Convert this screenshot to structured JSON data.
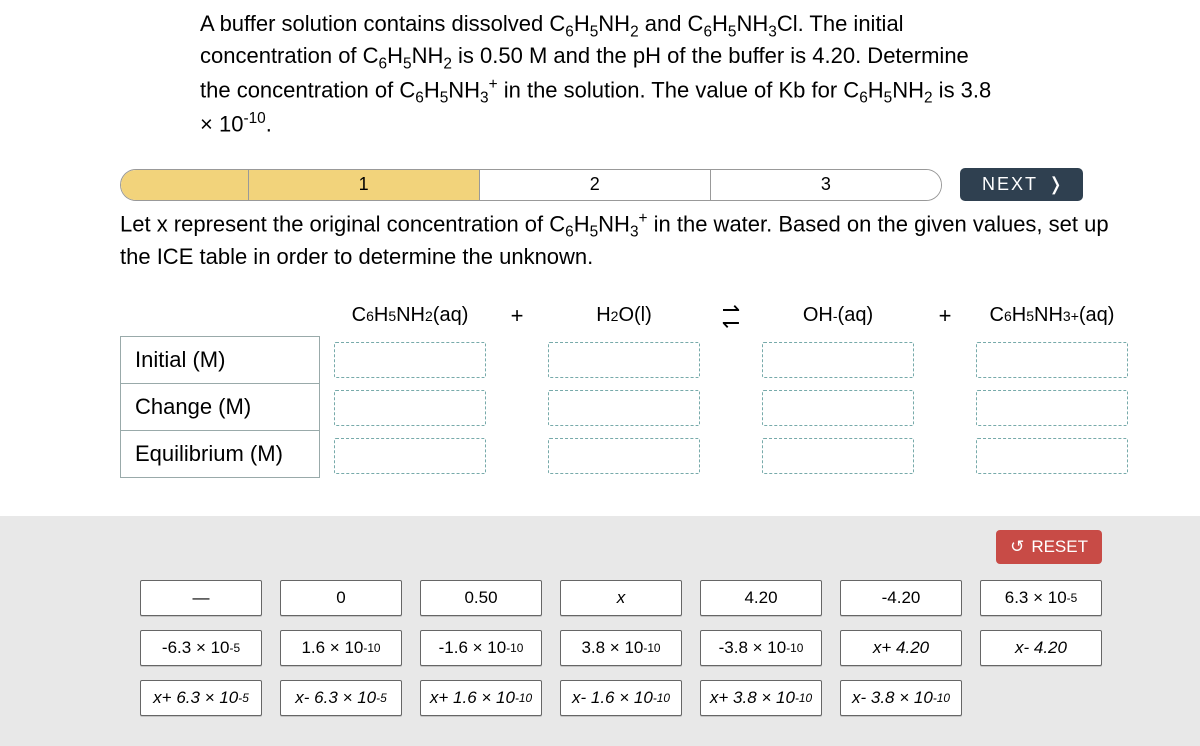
{
  "problem_html": "A buffer solution contains dissolved C<sub>6</sub>H<sub>5</sub>NH<sub>2</sub> and C<sub>6</sub>H<sub>5</sub>NH<sub>3</sub>Cl. The initial concentration of C<sub>6</sub>H<sub>5</sub>NH<sub>2</sub> is 0.50 M and the pH of the buffer is 4.20. Determine the concentration of C<sub>6</sub>H<sub>5</sub>NH<sub>3</sub><sup>+</sup> in the solution. The value of Kb for C<sub>6</sub>H<sub>5</sub>NH<sub>2</sub> is 3.8 × 10<sup>-10</sup>.",
  "steps": [
    "1",
    "2",
    "3"
  ],
  "next_label": "NEXT",
  "instruction_html": "Let x represent the original concentration of C<sub>6</sub>H<sub>5</sub>NH<sub>3</sub><sup>+</sup> in the water. Based on the given values, set up the ICE table in order to determine the unknown.",
  "ice": {
    "rows": [
      "Initial (M)",
      "Change (M)",
      "Equilibrium (M)"
    ],
    "species": [
      "C<sub>6</sub>H<sub>5</sub>NH<sub>2</sub>(aq)",
      "H<sub>2</sub>O(l)",
      "OH<sup>-</sup>(aq)",
      "C<sub>6</sub>H<sub>5</sub>NH<sub>3</sub><sup>+</sup>(aq)"
    ],
    "ops": [
      "+",
      "⇌",
      "+"
    ]
  },
  "reset_label": "RESET",
  "tiles": [
    {
      "html": "—",
      "upright": true
    },
    {
      "html": "0",
      "upright": true
    },
    {
      "html": "0.50",
      "upright": true
    },
    {
      "html": "<i>x</i>"
    },
    {
      "html": "4.20",
      "upright": true
    },
    {
      "html": "-4.20",
      "upright": true
    },
    {
      "html": "6.3 × 10<sup>-5</sup>",
      "upright": true
    },
    {
      "html": "-6.3 × 10<sup>-5</sup>",
      "upright": true
    },
    {
      "html": "1.6 × 10<sup>-10</sup>",
      "upright": true
    },
    {
      "html": "-1.6 × 10<sup>-10</sup>",
      "upright": true
    },
    {
      "html": "3.8 × 10<sup>-10</sup>",
      "upright": true
    },
    {
      "html": "-3.8 × 10<sup>-10</sup>",
      "upright": true
    },
    {
      "html": "<i>x</i> + 4.20"
    },
    {
      "html": "<i>x</i> - 4.20"
    },
    {
      "html": "<i>x</i> + 6.3 × 10<sup>-5</sup>"
    },
    {
      "html": "<i>x</i> - 6.3 × 10<sup>-5</sup>"
    },
    {
      "html": "<i>x</i> + 1.6 × 10<sup>-10</sup>"
    },
    {
      "html": "<i>x</i> - 1.6 × 10<sup>-10</sup>"
    },
    {
      "html": "<i>x</i> + 3.8 × 10<sup>-10</sup>"
    },
    {
      "html": "<i>x</i> - 3.8 × 10<sup>-10</sup>"
    }
  ]
}
